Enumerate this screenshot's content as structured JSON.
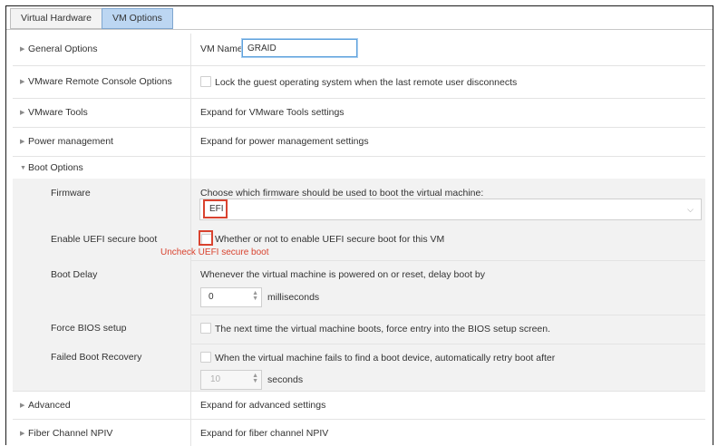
{
  "tabs": [
    "Virtual Hardware",
    "VM Options"
  ],
  "general": {
    "label": "General Options",
    "vm_name_label": "VM Name:",
    "vm_name_value": "GRAID"
  },
  "vmrc": {
    "label": "VMware Remote Console Options",
    "lock_text": "Lock the guest operating system when the last remote user disconnects"
  },
  "tools": {
    "label": "VMware Tools",
    "text": "Expand for VMware Tools settings"
  },
  "power": {
    "label": "Power management",
    "text": "Expand for power management settings"
  },
  "boot": {
    "label": "Boot Options",
    "firmware": {
      "label": "Firmware",
      "description": "Choose which firmware should be used to boot the virtual machine:",
      "selected": "EFI"
    },
    "uefi": {
      "label": "Enable UEFI secure boot",
      "text": "Whether or not to enable UEFI secure boot for this VM",
      "annotation": "Uncheck UEFI secure boot"
    },
    "delay": {
      "label": "Boot Delay",
      "text": "Whenever the virtual machine is powered on or reset, delay boot by",
      "value": "0",
      "unit": "milliseconds"
    },
    "bios": {
      "label": "Force BIOS setup",
      "text": "The next time the virtual machine boots, force entry into the BIOS setup screen."
    },
    "recovery": {
      "label": "Failed Boot Recovery",
      "text": "When the virtual machine fails to find a boot device, automatically retry boot after",
      "value": "10",
      "unit": "seconds"
    }
  },
  "advanced": {
    "label": "Advanced",
    "text": "Expand for advanced settings"
  },
  "fiber": {
    "label": "Fiber Channel NPIV",
    "text": "Expand for fiber channel NPIV"
  },
  "icons": {
    "expand": "triangle-right-icon",
    "collapse": "triangle-down-icon",
    "select": "chevron-down-icon",
    "spinner": "spinner-arrows-icon"
  },
  "colors": {
    "annotation": "#d9432f",
    "active_tab": "#bcd6f2",
    "focus": "#5ea1dc"
  }
}
